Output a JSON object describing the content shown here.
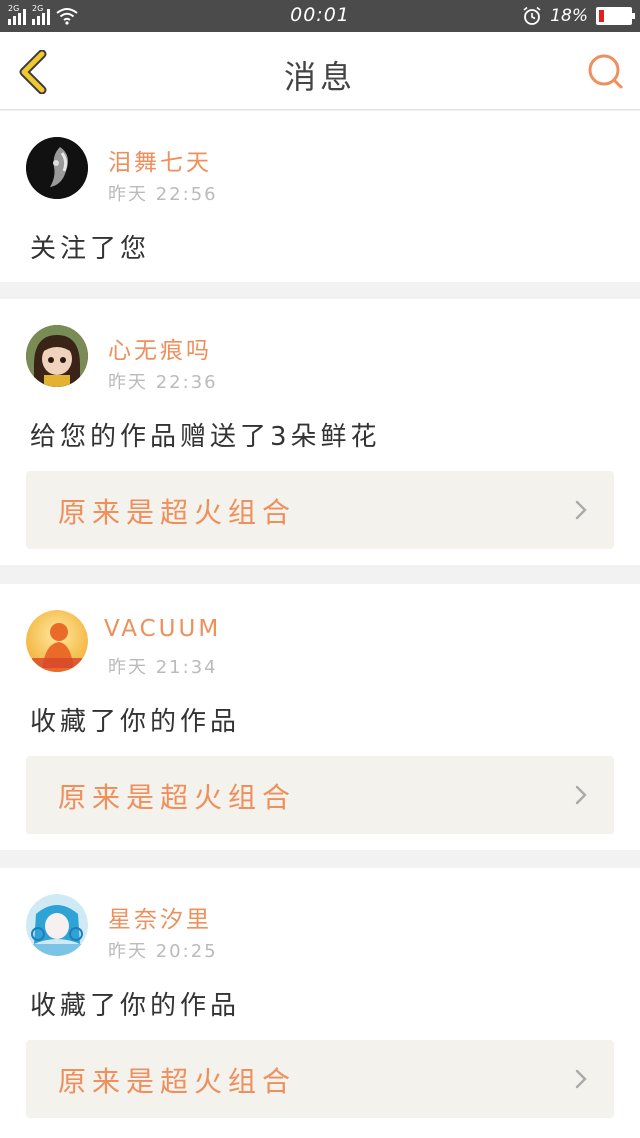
{
  "status_bar": {
    "net1": "2G",
    "net2": "2G",
    "time": "00:01",
    "battery_text": "18%",
    "battery_level": 0.18
  },
  "header": {
    "title": "消息",
    "back_icon": "chevron-left-icon",
    "search_icon": "search-icon"
  },
  "colors": {
    "accent": "#ef8f5c",
    "back_accent": "#f2c830",
    "link_bg": "#f3f2ed"
  },
  "messages": [
    {
      "username": "泪舞七天",
      "time": "昨天 22:56",
      "action": "关注了您",
      "work": ""
    },
    {
      "username": "心无痕吗",
      "time": "昨天 22:36",
      "action": "给您的作品赠送了3朵鲜花",
      "work": "原来是超火组合"
    },
    {
      "username": "VACUUM",
      "time": "昨天 21:34",
      "action": "收藏了你的作品",
      "work": "原来是超火组合"
    },
    {
      "username": "星奈汐里",
      "time": "昨天 20:25",
      "action": "收藏了你的作品",
      "work": "原来是超火组合"
    }
  ]
}
